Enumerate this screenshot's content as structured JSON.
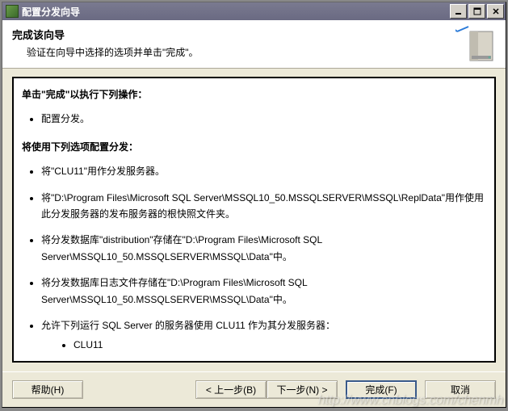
{
  "window": {
    "title": "配置分发向导"
  },
  "header": {
    "title": "完成该向导",
    "subtitle": "验证在向导中选择的选项并单击\"完成\"。"
  },
  "content": {
    "intro": "单击\"完成\"以执行下列操作：",
    "actions": [
      "配置分发。"
    ],
    "opts_heading": "将使用下列选项配置分发：",
    "opts": [
      "将\"CLU11\"用作分发服务器。",
      "将\"D:\\Program Files\\Microsoft SQL Server\\MSSQL10_50.MSSQLSERVER\\MSSQL\\ReplData\"用作使用此分发服务器的发布服务器的根快照文件夹。",
      "将分发数据库\"distribution\"存储在\"D:\\Program Files\\Microsoft SQL Server\\MSSQL10_50.MSSQLSERVER\\MSSQL\\Data\"中。",
      "将分发数据库日志文件存储在\"D:\\Program Files\\Microsoft SQL Server\\MSSQL10_50.MSSQLSERVER\\MSSQL\\Data\"中。",
      "允许下列运行 SQL Server 的服务器使用 CLU11 作为其分发服务器："
    ],
    "servers": [
      "CLU11"
    ]
  },
  "buttons": {
    "help": "帮助(H)",
    "back": "< 上一步(B)",
    "next": "下一步(N) >",
    "finish": "完成(F)",
    "cancel": "取消"
  },
  "watermark": "http://www.cnblogs.com/chenmh"
}
